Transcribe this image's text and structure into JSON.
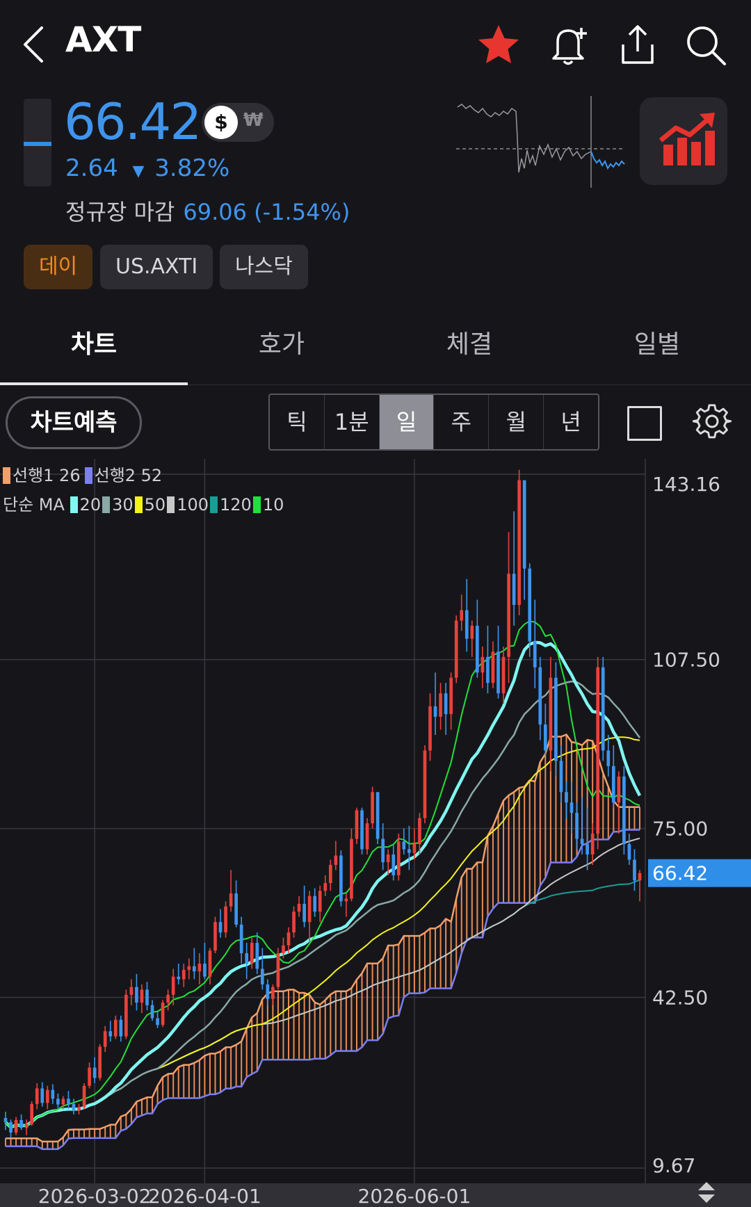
{
  "header": {
    "title": "AXT",
    "icons": [
      "back-icon",
      "star-icon",
      "alarm-add-icon",
      "share-icon",
      "search-icon"
    ]
  },
  "quote": {
    "price": "66.42",
    "currency_usd": "$",
    "currency_krw": "₩",
    "change": "2.64",
    "change_pct": "3.82%",
    "close_label": "정규장 마감",
    "close_value": "69.06 (-1.54%)",
    "colors": {
      "down": "#3f95ee",
      "up": "#e8423b"
    }
  },
  "tags": [
    "데이",
    "US.AXTI",
    "나스닥"
  ],
  "tabs": [
    {
      "label": "차트",
      "active": true
    },
    {
      "label": "호가",
      "active": false
    },
    {
      "label": "체결",
      "active": false
    },
    {
      "label": "일별",
      "active": false
    }
  ],
  "toolbar": {
    "predict_label": "차트예측",
    "periods": [
      {
        "label": "틱",
        "selected": false
      },
      {
        "label": "1분",
        "selected": false
      },
      {
        "label": "일",
        "selected": true
      },
      {
        "label": "주",
        "selected": false
      },
      {
        "label": "월",
        "selected": false
      },
      {
        "label": "년",
        "selected": false
      }
    ]
  },
  "legend": {
    "row1": [
      {
        "label": "선행1 26",
        "color": "#f2a06a"
      },
      {
        "label": "선행2 52",
        "color": "#7b7ff0"
      }
    ],
    "row2_prefix": "단순 MA",
    "row2": [
      {
        "label": "20",
        "color": "#7ff6f0"
      },
      {
        "label": "30",
        "color": "#8aa8a6"
      },
      {
        "label": "50",
        "color": "#f3f31a"
      },
      {
        "label": "100",
        "color": "#c8c8c8"
      },
      {
        "label": "120",
        "color": "#1d9c96"
      },
      {
        "label": "10",
        "color": "#22e03a"
      }
    ]
  },
  "chart_data": {
    "type": "candlestick",
    "y_ticks": [
      "143.16",
      "107.50",
      "75.00",
      "42.50",
      "9.67"
    ],
    "x_ticks": [
      "2026-03-02",
      "2026-04-01",
      "2026-06-01"
    ],
    "current_price_label": "66.42",
    "ylim": [
      9.67,
      143.16
    ],
    "grid": true,
    "candles": [
      [
        19.3,
        20.5,
        17,
        18.5
      ],
      [
        18.5,
        19,
        15.5,
        16.5
      ],
      [
        16.5,
        19.5,
        16,
        18.9
      ],
      [
        18.9,
        20,
        17,
        17.4
      ],
      [
        17.4,
        19,
        16,
        18.1
      ],
      [
        18.1,
        22.5,
        17.8,
        22
      ],
      [
        22,
        26,
        21,
        25
      ],
      [
        25,
        26.2,
        21.5,
        22.2
      ],
      [
        22.2,
        25.5,
        21,
        24.7
      ],
      [
        24.7,
        25.8,
        22,
        23
      ],
      [
        23,
        24,
        21.2,
        21.9
      ],
      [
        21.9,
        23.5,
        21,
        23
      ],
      [
        23,
        24.5,
        21,
        22
      ],
      [
        22,
        23,
        20,
        20.8
      ],
      [
        20.8,
        22,
        20,
        21.4
      ],
      [
        21.4,
        26,
        21,
        25.5
      ],
      [
        25.5,
        30,
        25,
        29
      ],
      [
        29,
        31,
        26,
        27
      ],
      [
        27,
        33.5,
        26.5,
        33
      ],
      [
        33,
        37,
        32,
        36
      ],
      [
        36,
        38,
        34,
        35
      ],
      [
        35,
        39,
        34.5,
        38.2
      ],
      [
        38.2,
        39,
        34,
        35
      ],
      [
        35,
        44,
        34.5,
        43
      ],
      [
        43,
        46,
        41,
        44.5
      ],
      [
        44.5,
        47,
        40,
        41.5
      ],
      [
        41.5,
        45,
        39.5,
        44
      ],
      [
        44,
        45.5,
        40,
        41
      ],
      [
        41,
        42,
        38,
        38.5
      ],
      [
        38.5,
        40,
        36.6,
        37.2
      ],
      [
        37.2,
        42,
        36.8,
        41.5
      ],
      [
        41.5,
        44,
        40,
        43
      ],
      [
        43,
        48,
        41,
        46.5
      ],
      [
        46.5,
        49,
        45,
        46
      ],
      [
        46,
        49,
        44.5,
        47.8
      ],
      [
        47.8,
        50,
        46,
        48.5
      ],
      [
        48.5,
        52,
        46,
        47.5
      ],
      [
        47.5,
        51,
        45,
        49
      ],
      [
        49,
        53,
        46,
        46.5
      ],
      [
        46.5,
        52,
        45,
        51.5
      ],
      [
        51.5,
        58,
        51,
        57
      ],
      [
        57,
        59.5,
        54,
        55
      ],
      [
        55,
        61,
        54,
        60
      ],
      [
        60,
        67,
        59,
        62.5
      ],
      [
        62.5,
        65,
        56,
        56.5
      ],
      [
        56.5,
        58,
        49,
        51
      ],
      [
        51,
        53,
        46,
        49
      ],
      [
        49,
        54,
        48,
        53
      ],
      [
        53,
        55,
        47,
        48
      ],
      [
        48,
        52,
        44,
        45
      ],
      [
        45,
        46,
        41,
        42.2
      ],
      [
        42.2,
        45,
        41,
        44.5
      ],
      [
        44.5,
        52,
        44,
        51
      ],
      [
        51,
        54,
        50,
        52.5
      ],
      [
        52.5,
        56,
        51,
        55
      ],
      [
        55,
        60,
        54,
        59
      ],
      [
        59,
        62,
        58,
        60.5
      ],
      [
        60.5,
        64,
        56,
        57
      ],
      [
        57,
        63,
        53,
        62
      ],
      [
        62,
        63.5,
        58,
        59
      ],
      [
        59,
        64,
        57,
        63
      ],
      [
        63,
        66,
        62,
        64.5
      ],
      [
        64.5,
        69,
        63,
        68
      ],
      [
        68,
        72.6,
        67,
        69.8
      ],
      [
        69.8,
        70.8,
        60,
        61
      ],
      [
        61,
        62.5,
        58,
        61.5
      ],
      [
        61.5,
        75,
        61,
        73
      ],
      [
        73,
        79,
        72,
        78.5
      ],
      [
        78.5,
        79,
        70,
        71
      ],
      [
        71,
        77,
        70,
        76
      ],
      [
        76,
        83,
        75,
        82
      ],
      [
        82,
        79.5,
        72,
        73
      ],
      [
        73,
        76,
        67,
        68.5
      ],
      [
        68.5,
        71,
        66,
        70
      ],
      [
        70,
        72,
        65,
        66
      ],
      [
        66,
        74,
        65,
        72.5
      ],
      [
        72.5,
        75,
        70,
        71
      ],
      [
        71,
        75.5,
        67,
        70.3
      ],
      [
        70.3,
        75,
        69,
        72
      ],
      [
        72,
        78,
        70,
        77
      ],
      [
        77,
        91,
        76,
        90
      ],
      [
        90,
        101,
        88,
        98.5
      ],
      [
        98.5,
        105,
        93,
        96.5
      ],
      [
        96.5,
        103,
        94,
        101
      ],
      [
        101,
        103,
        93,
        97
      ],
      [
        97,
        105,
        94,
        104
      ],
      [
        104,
        116,
        103,
        115
      ],
      [
        115,
        120,
        113,
        117
      ],
      [
        117,
        123,
        109,
        111.5
      ],
      [
        111.5,
        115,
        108,
        114
      ],
      [
        114,
        119,
        104,
        105
      ],
      [
        105,
        110,
        102,
        108
      ],
      [
        108,
        114,
        101,
        103
      ],
      [
        103,
        111,
        102,
        109
      ],
      [
        109,
        114,
        100,
        101
      ],
      [
        101,
        110,
        99,
        108
      ],
      [
        108,
        132,
        103,
        124
      ],
      [
        124,
        136,
        114,
        118
      ],
      [
        118,
        144,
        116,
        142
      ],
      [
        142,
        136,
        119,
        125
      ],
      [
        125,
        126,
        108,
        111
      ],
      [
        111,
        119,
        102,
        106
      ],
      [
        106,
        108,
        92,
        95
      ],
      [
        95,
        99,
        89,
        90
      ],
      [
        90,
        108,
        86,
        104
      ],
      [
        104,
        107,
        85,
        88
      ],
      [
        88,
        91,
        80,
        82
      ],
      [
        82,
        84,
        77,
        80
      ],
      [
        80,
        84,
        74,
        78
      ],
      [
        78,
        80,
        71,
        73
      ],
      [
        73,
        81,
        70,
        72
      ],
      [
        72,
        79,
        67,
        70
      ],
      [
        70,
        76,
        68,
        74
      ],
      [
        74,
        108,
        71,
        106
      ],
      [
        106,
        108,
        88,
        90
      ],
      [
        90,
        93,
        85,
        87
      ],
      [
        87,
        91,
        79,
        80
      ],
      [
        80,
        86,
        74,
        85
      ],
      [
        85,
        87,
        70,
        72
      ],
      [
        72,
        74,
        68,
        69
      ],
      [
        69,
        71,
        63,
        65
      ],
      [
        65,
        67,
        61,
        66.42
      ]
    ]
  }
}
